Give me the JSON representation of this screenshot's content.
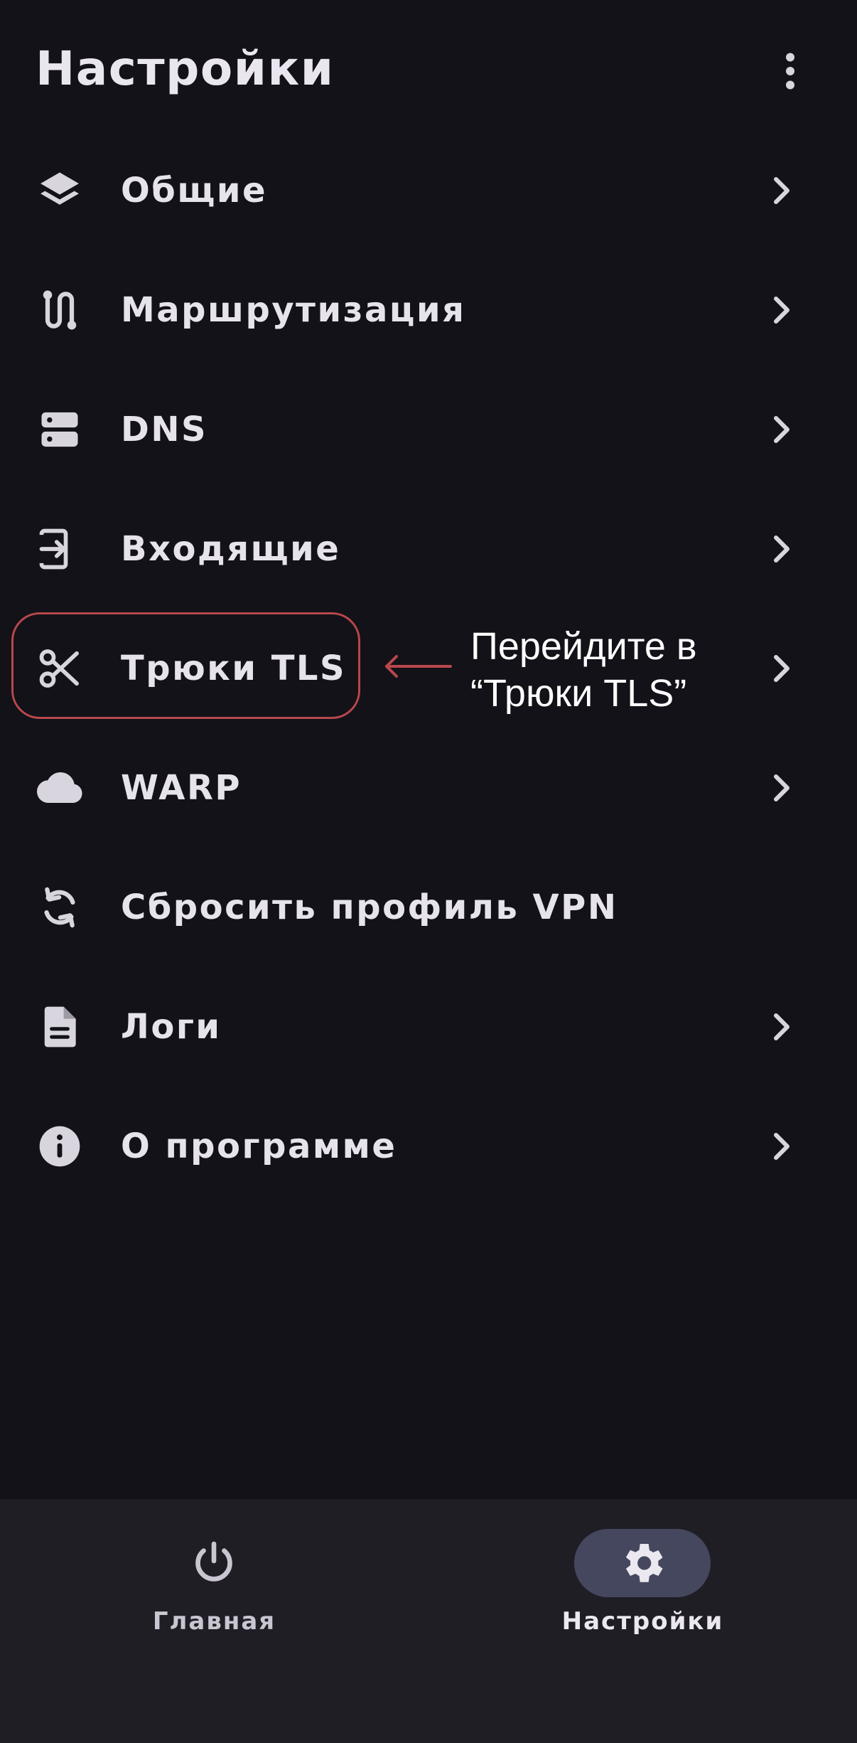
{
  "header": {
    "title": "Настройки",
    "more_icon": "more-vert-icon"
  },
  "menu": [
    {
      "id": "general",
      "label": "Общие",
      "icon": "layers-icon",
      "has_chevron": true
    },
    {
      "id": "routing",
      "label": "Маршрутизация",
      "icon": "route-icon",
      "has_chevron": true
    },
    {
      "id": "dns",
      "label": "DNS",
      "icon": "dns-icon",
      "has_chevron": true
    },
    {
      "id": "inbound",
      "label": "Входящие",
      "icon": "login-icon",
      "has_chevron": true
    },
    {
      "id": "tls-tricks",
      "label": "Трюки TLS",
      "icon": "scissors-icon",
      "has_chevron": true
    },
    {
      "id": "warp",
      "label": "WARP",
      "icon": "cloud-icon",
      "has_chevron": true
    },
    {
      "id": "reset-vpn",
      "label": "Сбросить профиль VPN",
      "icon": "sync-icon",
      "has_chevron": false
    },
    {
      "id": "logs",
      "label": "Логи",
      "icon": "description-icon",
      "has_chevron": true
    },
    {
      "id": "about",
      "label": "О программе",
      "icon": "info-icon",
      "has_chevron": true
    }
  ],
  "annotation": {
    "line1": "Перейдите в",
    "line2": "“Трюки TLS”",
    "target": "tls-tricks",
    "color": "#b8474c"
  },
  "bottom_nav": {
    "items": [
      {
        "label": "Главная",
        "icon": "power-icon",
        "selected": false
      },
      {
        "label": "Настройки",
        "icon": "gear-icon",
        "selected": true
      }
    ]
  },
  "colors": {
    "background": "#121218",
    "nav_background": "#1f1e25",
    "text": "#e6e3ec",
    "selected_pill": "#45475e"
  }
}
